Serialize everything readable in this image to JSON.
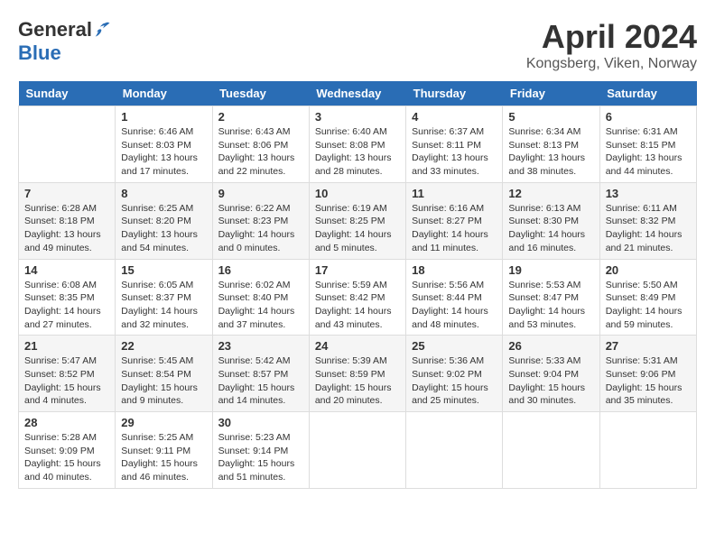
{
  "header": {
    "logo_general": "General",
    "logo_blue": "Blue",
    "month_title": "April 2024",
    "location": "Kongsberg, Viken, Norway"
  },
  "weekdays": [
    "Sunday",
    "Monday",
    "Tuesday",
    "Wednesday",
    "Thursday",
    "Friday",
    "Saturday"
  ],
  "weeks": [
    [
      {
        "day": "",
        "info": ""
      },
      {
        "day": "1",
        "info": "Sunrise: 6:46 AM\nSunset: 8:03 PM\nDaylight: 13 hours\nand 17 minutes."
      },
      {
        "day": "2",
        "info": "Sunrise: 6:43 AM\nSunset: 8:06 PM\nDaylight: 13 hours\nand 22 minutes."
      },
      {
        "day": "3",
        "info": "Sunrise: 6:40 AM\nSunset: 8:08 PM\nDaylight: 13 hours\nand 28 minutes."
      },
      {
        "day": "4",
        "info": "Sunrise: 6:37 AM\nSunset: 8:11 PM\nDaylight: 13 hours\nand 33 minutes."
      },
      {
        "day": "5",
        "info": "Sunrise: 6:34 AM\nSunset: 8:13 PM\nDaylight: 13 hours\nand 38 minutes."
      },
      {
        "day": "6",
        "info": "Sunrise: 6:31 AM\nSunset: 8:15 PM\nDaylight: 13 hours\nand 44 minutes."
      }
    ],
    [
      {
        "day": "7",
        "info": "Sunrise: 6:28 AM\nSunset: 8:18 PM\nDaylight: 13 hours\nand 49 minutes."
      },
      {
        "day": "8",
        "info": "Sunrise: 6:25 AM\nSunset: 8:20 PM\nDaylight: 13 hours\nand 54 minutes."
      },
      {
        "day": "9",
        "info": "Sunrise: 6:22 AM\nSunset: 8:23 PM\nDaylight: 14 hours\nand 0 minutes."
      },
      {
        "day": "10",
        "info": "Sunrise: 6:19 AM\nSunset: 8:25 PM\nDaylight: 14 hours\nand 5 minutes."
      },
      {
        "day": "11",
        "info": "Sunrise: 6:16 AM\nSunset: 8:27 PM\nDaylight: 14 hours\nand 11 minutes."
      },
      {
        "day": "12",
        "info": "Sunrise: 6:13 AM\nSunset: 8:30 PM\nDaylight: 14 hours\nand 16 minutes."
      },
      {
        "day": "13",
        "info": "Sunrise: 6:11 AM\nSunset: 8:32 PM\nDaylight: 14 hours\nand 21 minutes."
      }
    ],
    [
      {
        "day": "14",
        "info": "Sunrise: 6:08 AM\nSunset: 8:35 PM\nDaylight: 14 hours\nand 27 minutes."
      },
      {
        "day": "15",
        "info": "Sunrise: 6:05 AM\nSunset: 8:37 PM\nDaylight: 14 hours\nand 32 minutes."
      },
      {
        "day": "16",
        "info": "Sunrise: 6:02 AM\nSunset: 8:40 PM\nDaylight: 14 hours\nand 37 minutes."
      },
      {
        "day": "17",
        "info": "Sunrise: 5:59 AM\nSunset: 8:42 PM\nDaylight: 14 hours\nand 43 minutes."
      },
      {
        "day": "18",
        "info": "Sunrise: 5:56 AM\nSunset: 8:44 PM\nDaylight: 14 hours\nand 48 minutes."
      },
      {
        "day": "19",
        "info": "Sunrise: 5:53 AM\nSunset: 8:47 PM\nDaylight: 14 hours\nand 53 minutes."
      },
      {
        "day": "20",
        "info": "Sunrise: 5:50 AM\nSunset: 8:49 PM\nDaylight: 14 hours\nand 59 minutes."
      }
    ],
    [
      {
        "day": "21",
        "info": "Sunrise: 5:47 AM\nSunset: 8:52 PM\nDaylight: 15 hours\nand 4 minutes."
      },
      {
        "day": "22",
        "info": "Sunrise: 5:45 AM\nSunset: 8:54 PM\nDaylight: 15 hours\nand 9 minutes."
      },
      {
        "day": "23",
        "info": "Sunrise: 5:42 AM\nSunset: 8:57 PM\nDaylight: 15 hours\nand 14 minutes."
      },
      {
        "day": "24",
        "info": "Sunrise: 5:39 AM\nSunset: 8:59 PM\nDaylight: 15 hours\nand 20 minutes."
      },
      {
        "day": "25",
        "info": "Sunrise: 5:36 AM\nSunset: 9:02 PM\nDaylight: 15 hours\nand 25 minutes."
      },
      {
        "day": "26",
        "info": "Sunrise: 5:33 AM\nSunset: 9:04 PM\nDaylight: 15 hours\nand 30 minutes."
      },
      {
        "day": "27",
        "info": "Sunrise: 5:31 AM\nSunset: 9:06 PM\nDaylight: 15 hours\nand 35 minutes."
      }
    ],
    [
      {
        "day": "28",
        "info": "Sunrise: 5:28 AM\nSunset: 9:09 PM\nDaylight: 15 hours\nand 40 minutes."
      },
      {
        "day": "29",
        "info": "Sunrise: 5:25 AM\nSunset: 9:11 PM\nDaylight: 15 hours\nand 46 minutes."
      },
      {
        "day": "30",
        "info": "Sunrise: 5:23 AM\nSunset: 9:14 PM\nDaylight: 15 hours\nand 51 minutes."
      },
      {
        "day": "",
        "info": ""
      },
      {
        "day": "",
        "info": ""
      },
      {
        "day": "",
        "info": ""
      },
      {
        "day": "",
        "info": ""
      }
    ]
  ]
}
